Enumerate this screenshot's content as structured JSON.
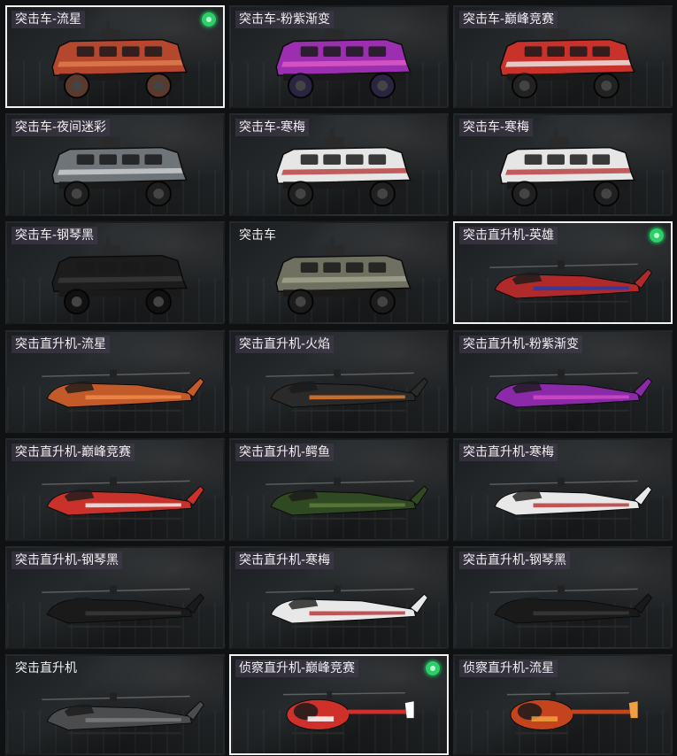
{
  "cards": [
    {
      "label": "突击车-流星",
      "kind": "truck",
      "body": "#b5472f",
      "accent": "#e0804f",
      "wheel": "#5a3a2c",
      "selected": true,
      "equipped": true,
      "tag": true
    },
    {
      "label": "突击车-粉紫渐变",
      "kind": "truck",
      "body": "#9b2fb0",
      "accent": "#e25ac7",
      "wheel": "#2a2440",
      "selected": false,
      "equipped": false,
      "tag": true
    },
    {
      "label": "突击车-巅峰竞赛",
      "kind": "truck",
      "body": "#c8322a",
      "accent": "#eeeeee",
      "wheel": "#222222",
      "selected": false,
      "equipped": false,
      "tag": true
    },
    {
      "label": "突击车-夜间迷彩",
      "kind": "truck",
      "body": "#6f7478",
      "accent": "#cfd3d6",
      "wheel": "#1e1e1e",
      "selected": false,
      "equipped": false,
      "tag": true
    },
    {
      "label": "突击车-寒梅",
      "kind": "truck",
      "body": "#e6e6e6",
      "accent": "#b83a3a",
      "wheel": "#202020",
      "selected": false,
      "equipped": false,
      "tag": true
    },
    {
      "label": "突击车-寒梅",
      "kind": "truck",
      "body": "#e6e6e6",
      "accent": "#b83a3a",
      "wheel": "#202020",
      "selected": false,
      "equipped": false,
      "tag": true
    },
    {
      "label": "突击车-钢琴黑",
      "kind": "truck",
      "body": "#1c1c1c",
      "accent": "#3a3a3a",
      "wheel": "#111111",
      "selected": false,
      "equipped": false,
      "tag": true
    },
    {
      "label": "突击车",
      "kind": "truck",
      "body": "#6f705f",
      "accent": "#a5a690",
      "wheel": "#1c1c1c",
      "selected": false,
      "equipped": false,
      "tag": false
    },
    {
      "label": "突击直升机-英雄",
      "kind": "heli",
      "body": "#b02a2a",
      "accent": "#2a3aa8",
      "wheel": "#ddd",
      "selected": true,
      "equipped": true,
      "tag": true
    },
    {
      "label": "突击直升机-流星",
      "kind": "heli",
      "body": "#c25a2a",
      "accent": "#f08a4a",
      "wheel": "#222",
      "selected": false,
      "equipped": false,
      "tag": true
    },
    {
      "label": "突击直升机-火焰",
      "kind": "heli",
      "body": "#2a2a2a",
      "accent": "#e07a2a",
      "wheel": "#222",
      "selected": false,
      "equipped": false,
      "tag": true
    },
    {
      "label": "突击直升机-粉紫渐变",
      "kind": "heli",
      "body": "#8a2aa8",
      "accent": "#d04ac8",
      "wheel": "#222",
      "selected": false,
      "equipped": false,
      "tag": true
    },
    {
      "label": "突击直升机-巅峰竞赛",
      "kind": "heli",
      "body": "#c8322a",
      "accent": "#eeeeee",
      "wheel": "#222",
      "selected": false,
      "equipped": false,
      "tag": true
    },
    {
      "label": "突击直升机-鳄鱼",
      "kind": "heli",
      "body": "#2f4a22",
      "accent": "#5e7a3a",
      "wheel": "#222",
      "selected": false,
      "equipped": false,
      "tag": true
    },
    {
      "label": "突击直升机-寒梅",
      "kind": "heli",
      "body": "#e8e8e8",
      "accent": "#b83a3a",
      "wheel": "#222",
      "selected": false,
      "equipped": false,
      "tag": true
    },
    {
      "label": "突击直升机-钢琴黑",
      "kind": "heli",
      "body": "#1a1a1a",
      "accent": "#3a3a3a",
      "wheel": "#222",
      "selected": false,
      "equipped": false,
      "tag": true
    },
    {
      "label": "突击直升机-寒梅",
      "kind": "heli",
      "body": "#e8e8e8",
      "accent": "#b83a3a",
      "wheel": "#222",
      "selected": false,
      "equipped": false,
      "tag": true
    },
    {
      "label": "突击直升机-钢琴黑",
      "kind": "heli",
      "body": "#1a1a1a",
      "accent": "#3a3a3a",
      "wheel": "#222",
      "selected": false,
      "equipped": false,
      "tag": true
    },
    {
      "label": "突击直升机",
      "kind": "heli",
      "body": "#4a4c4e",
      "accent": "#7a7c7e",
      "wheel": "#222",
      "selected": false,
      "equipped": false,
      "tag": false
    },
    {
      "label": "侦察直升机-巅峰竞赛",
      "kind": "scout",
      "body": "#d0302a",
      "accent": "#ffffff",
      "wheel": "#222",
      "selected": true,
      "equipped": true,
      "tag": true
    },
    {
      "label": "侦察直升机-流星",
      "kind": "scout",
      "body": "#c4441e",
      "accent": "#f0a040",
      "wheel": "#222",
      "selected": false,
      "equipped": false,
      "tag": true
    }
  ]
}
